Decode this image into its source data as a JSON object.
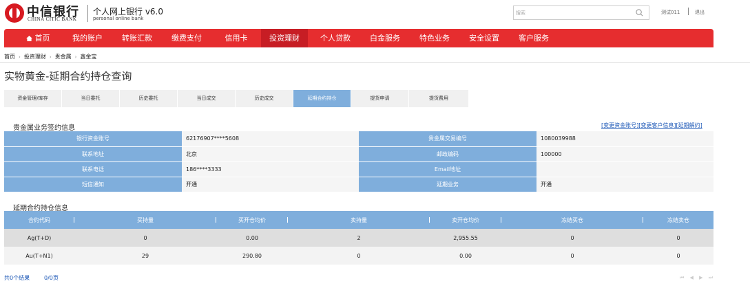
{
  "header": {
    "bank_name_cn": "中信银行",
    "bank_name_en": "CHINA CITIC BANK",
    "product_cn": "个人网上银行 v6.0",
    "product_en": "personal online bank",
    "search_placeholder": "搜索",
    "user_name": "测试011",
    "logout_label": "退出"
  },
  "nav": {
    "items": [
      {
        "label": "首页",
        "icon": "home-icon"
      },
      {
        "label": "我的账户"
      },
      {
        "label": "转账汇款"
      },
      {
        "label": "缴费支付"
      },
      {
        "label": "信用卡"
      },
      {
        "label": "投资理财",
        "active": true
      },
      {
        "label": "个人贷款"
      },
      {
        "label": "白金服务"
      },
      {
        "label": "特色业务"
      },
      {
        "label": "安全设置"
      },
      {
        "label": "客户服务"
      }
    ]
  },
  "breadcrumb": [
    "首页",
    "投资理财",
    "贵金属",
    "鑫金宝"
  ],
  "page_title": "实物黄金-延期合约持仓查询",
  "subtabs": [
    {
      "label": "资金管理/库存"
    },
    {
      "label": "当日委托"
    },
    {
      "label": "历史委托"
    },
    {
      "label": "当日成交"
    },
    {
      "label": "历史成交"
    },
    {
      "label": "延期合约持仓",
      "active": true
    },
    {
      "label": "提货申请"
    },
    {
      "label": "提货费用"
    }
  ],
  "sign_info": {
    "title": "贵金属业务签约信息",
    "links": "[变更资金账号][变更客户信息][延期解约]",
    "rows": [
      [
        {
          "label": "银行资金账号",
          "value": "62176907****5608"
        },
        {
          "label": "贵金属交易编号",
          "value": "1080039988"
        }
      ],
      [
        {
          "label": "联系地址",
          "value": "北京"
        },
        {
          "label": "邮政编码",
          "value": "100000"
        }
      ],
      [
        {
          "label": "联系电话",
          "value": "186****3333"
        },
        {
          "label": "Email地址",
          "value": ""
        }
      ],
      [
        {
          "label": "短信通知",
          "value": "开通"
        },
        {
          "label": "延期业务",
          "value": "开通"
        }
      ]
    ]
  },
  "holdings": {
    "title": "延期合约持仓信息",
    "columns": [
      "合约代码",
      "买持量",
      "买开仓均价",
      "卖持量",
      "卖开仓均价",
      "冻结买仓",
      "冻结卖仓"
    ],
    "rows": [
      [
        "Ag(T+D)",
        "0",
        "0.00",
        "2",
        "2,955.55",
        "0",
        "0"
      ],
      [
        "Au(T+N1)",
        "29",
        "290.80",
        "0",
        "0.00",
        "0",
        "0"
      ]
    ]
  },
  "footer": {
    "result_count": "共0个结果",
    "page_count": "0/0页",
    "pager": "⏮ ◀ ▶ ⏭"
  },
  "colors": {
    "nav_red": "#e62d2f",
    "nav_active": "#c71d24",
    "table_header_blue": "#7faedc",
    "link_blue": "#1a56b6"
  }
}
